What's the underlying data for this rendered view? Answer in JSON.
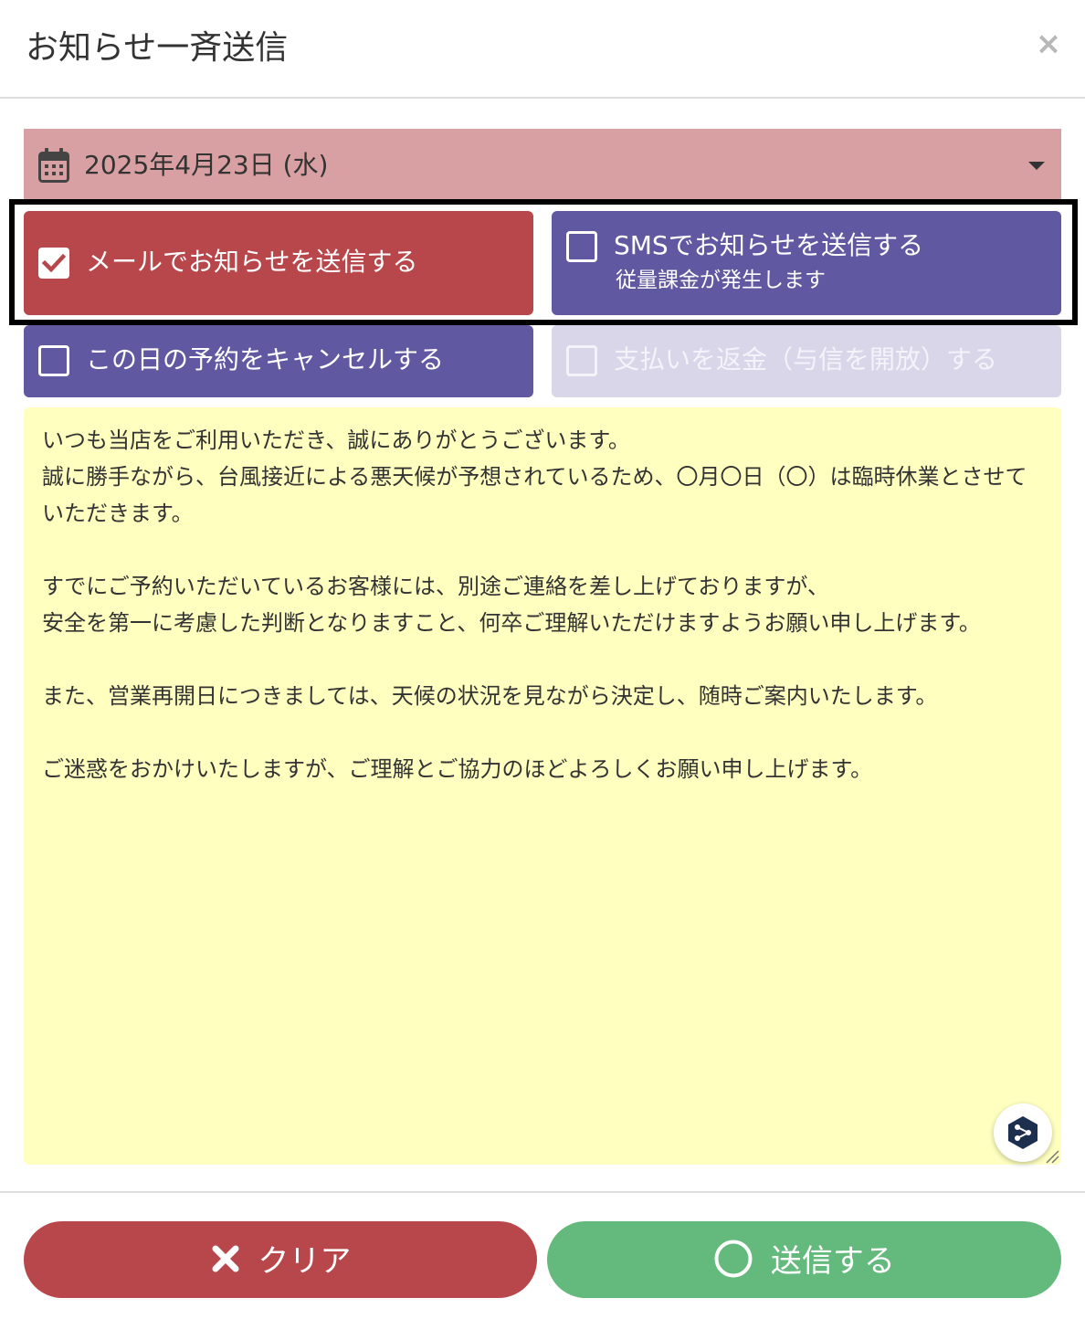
{
  "dialog": {
    "title": "お知らせ一斉送信",
    "close_icon": "×"
  },
  "date_select": {
    "value": "2025年4月23日 (水)",
    "icon": "calendar-icon"
  },
  "options": {
    "email": {
      "label": "メールでお知らせを送信する",
      "checked": true
    },
    "sms": {
      "label": "SMSでお知らせを送信する",
      "note": "従量課金が発生します",
      "checked": false
    },
    "cancel_reservations": {
      "label": "この日の予約をキャンセルする",
      "checked": false
    },
    "refund": {
      "label": "支払いを返金（与信を開放）する",
      "checked": false,
      "disabled": true
    }
  },
  "message": {
    "text": "いつも当店をご利用いただき、誠にありがとうございます。\n誠に勝手ながら、台風接近による悪天候が予想されているため、〇月〇日（〇）は臨時休業とさせていただきます。\n\nすでにご予約いただいているお客様には、別途ご連絡を差し上げておりますが、\n安全を第一に考慮した判断となりますこと、何卒ご理解いただけますようお願い申し上げます。\n\nまた、営業再開日につきましては、天候の状況を見ながら決定し、随時ご案内いたします。\n\nご迷惑をおかけいたしますが、ご理解とご協力のほどよろしくお願い申し上げます。"
  },
  "footer": {
    "clear_label": "クリア",
    "send_label": "送信する"
  },
  "colors": {
    "date_bg": "#d8a0a3",
    "email_bg": "#b8474b",
    "sms_bg": "#6158a2",
    "refund_disabled_bg": "#d9d6ea",
    "message_bg": "#ffffc0",
    "clear_bg": "#b8474b",
    "send_bg": "#64b97c"
  }
}
